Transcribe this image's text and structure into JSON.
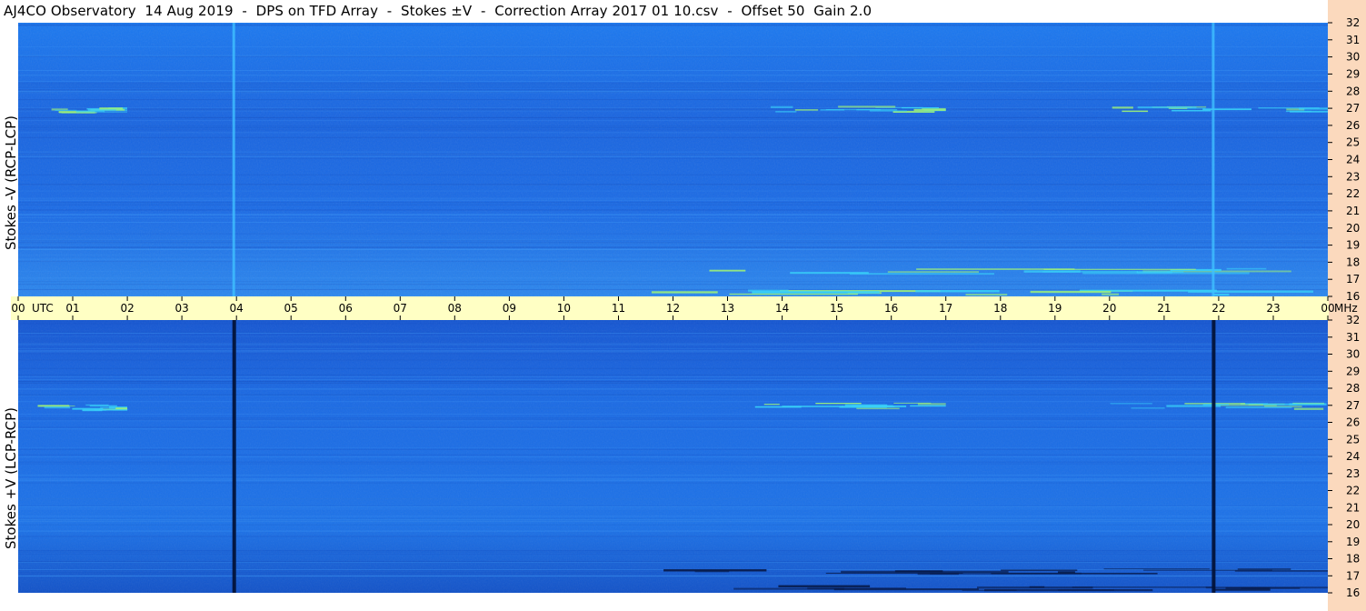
{
  "title": "AJ4CO Observatory  14 Aug 2019  -  DPS on TFD Array  -  Stokes ±V  -  Correction Array 2017 01 10.csv  -  Offset 50  Gain 2.0",
  "panels": [
    {
      "id": "top",
      "ylabel": "Stokes -V (RCP-LCP)"
    },
    {
      "id": "bottom",
      "ylabel": "Stokes +V (LCP-RCP)"
    }
  ],
  "chart_data": {
    "type": "heatmap",
    "title": "AJ4CO Observatory  14 Aug 2019  -  DPS on TFD Array  -  Stokes ±V  -  Correction Array 2017 01 10.csv  -  Offset 50  Gain 2.0",
    "x_unit": "UTC",
    "y_unit": "MHz",
    "xlim": [
      0,
      24
    ],
    "ylim": [
      16,
      32
    ],
    "x_ticks": [
      "00",
      "01",
      "02",
      "03",
      "04",
      "05",
      "06",
      "07",
      "08",
      "09",
      "10",
      "11",
      "12",
      "13",
      "14",
      "15",
      "16",
      "17",
      "18",
      "19",
      "20",
      "21",
      "22",
      "23",
      "00"
    ],
    "y_ticks": [
      "16",
      "17",
      "18",
      "19",
      "20",
      "21",
      "22",
      "23",
      "24",
      "25",
      "26",
      "27",
      "28",
      "29",
      "30",
      "31",
      "32"
    ],
    "colors": {
      "background_blue": "#1a6be6",
      "bright": "#2fc8f5",
      "dark_line": "#061f55",
      "time_strip": "#ffffc4",
      "freq_strip": "#fbd9bd"
    },
    "panels": [
      {
        "name": "Stokes -V (RCP-LCP)",
        "vertical_lines": [
          {
            "x": 3.95,
            "kind": "bright"
          },
          {
            "x": 21.9,
            "kind": "bright"
          }
        ],
        "emission_bands": [
          {
            "x": [
              0.3,
              2.0
            ],
            "y": 26.9,
            "kind": "bright"
          },
          {
            "x": [
              13.5,
              17.0
            ],
            "y": 27.0,
            "kind": "bright"
          },
          {
            "x": [
              20.0,
              24.0
            ],
            "y": 27.0,
            "kind": "bright"
          },
          {
            "x": [
              11.9,
              24.0
            ],
            "y": 17.5,
            "kind": "bright"
          },
          {
            "x": [
              11.5,
              24.0
            ],
            "y": 16.3,
            "kind": "bright"
          }
        ]
      },
      {
        "name": "Stokes +V (LCP-RCP)",
        "vertical_lines": [
          {
            "x": 3.95,
            "kind": "dark"
          },
          {
            "x": 21.9,
            "kind": "dark"
          }
        ],
        "emission_bands": [
          {
            "x": [
              0.3,
              2.0
            ],
            "y": 26.9,
            "kind": "bright"
          },
          {
            "x": [
              13.3,
              17.0
            ],
            "y": 27.0,
            "kind": "bright"
          },
          {
            "x": [
              20.0,
              24.0
            ],
            "y": 27.0,
            "kind": "bright"
          },
          {
            "x": [
              11.5,
              24.0
            ],
            "y": 17.3,
            "kind": "dark"
          },
          {
            "x": [
              11.5,
              24.0
            ],
            "y": 16.3,
            "kind": "dark"
          }
        ]
      }
    ]
  }
}
